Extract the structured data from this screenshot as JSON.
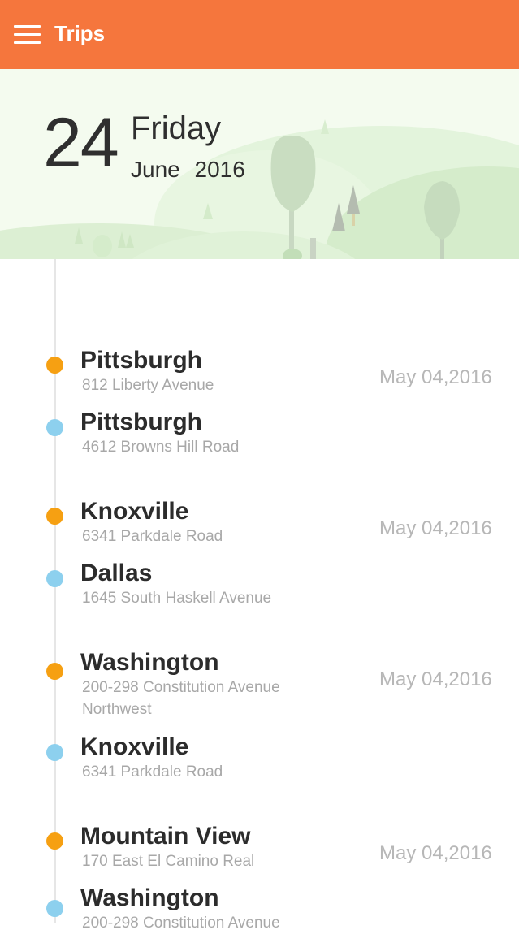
{
  "app_bar": {
    "title": "Trips",
    "menu_icon": "hamburger-menu-icon",
    "background": "#F5763D"
  },
  "header": {
    "day": "24",
    "weekday": "Friday",
    "month_year": "June 2016"
  },
  "colors": {
    "origin_dot": "#F6A012",
    "destination_dot": "#8DD0EE"
  },
  "trips": [
    {
      "date": "May 04,2016",
      "origin": {
        "city": "Pittsburgh",
        "address": "812 Liberty Avenue"
      },
      "destination": {
        "city": "Pittsburgh",
        "address": "4612 Browns Hill Road"
      }
    },
    {
      "date": "May 04,2016",
      "origin": {
        "city": "Knoxville",
        "address": "6341 Parkdale Road"
      },
      "destination": {
        "city": "Dallas",
        "address": "1645 South Haskell Avenue"
      }
    },
    {
      "date": "May 04,2016",
      "origin": {
        "city": "Washington",
        "address": "200-298 Constitution Avenue Northwest"
      },
      "destination": {
        "city": "Knoxville",
        "address": "6341 Parkdale Road"
      }
    },
    {
      "date": "May 04,2016",
      "origin": {
        "city": "Mountain View",
        "address": "170 East El Camino Real"
      },
      "destination": {
        "city": "Washington",
        "address": "200-298 Constitution Avenue"
      }
    }
  ]
}
